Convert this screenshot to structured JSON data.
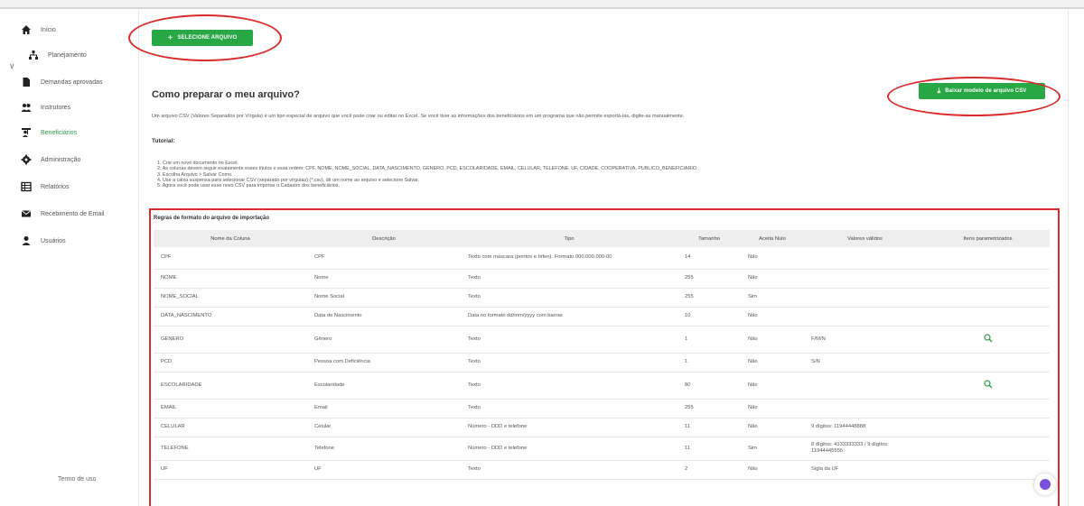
{
  "sidebar": {
    "items": [
      {
        "label": "Início",
        "icon": "home-icon"
      },
      {
        "label": "Planejamento",
        "icon": "sitemap-icon"
      },
      {
        "label": "Demandas aprovadas",
        "icon": "document-icon"
      },
      {
        "label": "Instrutores",
        "icon": "users-icon"
      },
      {
        "label": "Beneficiários",
        "icon": "person-board-icon"
      },
      {
        "label": "Administração",
        "icon": "gear-icon"
      },
      {
        "label": "Relatórios",
        "icon": "table-icon"
      },
      {
        "label": "Recebimento de Email",
        "icon": "envelope-icon"
      },
      {
        "label": "Usuários",
        "icon": "user-icon"
      }
    ],
    "active_index": 4,
    "terms": "Termo de uso"
  },
  "main": {
    "select_button": "SELECIONE ARQUIVO",
    "download_button": "Baixar modelo de arquivo CSV",
    "title": "Como preparar o meu arquivo?",
    "description": "Um arquivo CSV (Valores Separados por Vírgula) é um tipo especial de arquivo que você pode criar ou editar no Excel. Se você tiver as informações dos beneficiários em um programa que não permite exportá-las, digite-as manualmente.",
    "tutorial_title": "Tutorial:",
    "steps": [
      "1. Crie um novo documento no Excel.",
      "2. As colunas devem seguir exatamente esses títulos e essa ordem: CPF, NOME, NOME_SOCIAL, DATA_NASCIMENTO, GENERO, PCD, ESCOLARIDADE, EMAIL, CELULAR, TELEFONE, UF, CIDADE, COOPERATIVA, PUBLICO_BENEFICIARIO.",
      "3. Escolha Arquivo > Salvar Como.",
      "4. Use a caixa suspensa para selecionar CSV (separado por vírgulas) (*.csv), dê um nome ao arquivo e selecione Salvar.",
      "5. Agora você pode usar esse novo CSV para importar o Cadastro dos beneficiários."
    ]
  },
  "table": {
    "title": "Regras de formato do arquivo de importação",
    "headers": [
      "Nome da Coluna",
      "Descrição",
      "Tipo",
      "Tamanho",
      "Aceita Nulo",
      "Valores válidos",
      "Itens parametrizados"
    ],
    "rows": [
      {
        "name": "CPF",
        "desc": "CPF",
        "type": "Texto com máscara (pontos e hífen). Formato 000.000.000-00",
        "size": "14",
        "null": "Não",
        "valid": "",
        "param": ""
      },
      {
        "name": "NOME",
        "desc": "Nome",
        "type": "Texto",
        "size": "255",
        "null": "Não",
        "valid": "",
        "param": ""
      },
      {
        "name": "NOME_SOCIAL",
        "desc": "Nome Social",
        "type": "Texto",
        "size": "255",
        "null": "Sim",
        "valid": "",
        "param": ""
      },
      {
        "name": "DATA_NASCIMENTO",
        "desc": "Data de Nascimento",
        "type": "Data no formato dd/mm/yyyy com barras",
        "size": "10",
        "null": "Não",
        "valid": "",
        "param": ""
      },
      {
        "name": "GENERO",
        "desc": "Gênero",
        "type": "Texto",
        "size": "1",
        "null": "Não",
        "valid": "F/M/N",
        "param": "search-icon"
      },
      {
        "name": "PCD",
        "desc": "Pessoa com Deficiência",
        "type": "Texto",
        "size": "1",
        "null": "Não",
        "valid": "S/N",
        "param": ""
      },
      {
        "name": "ESCOLARIDADE",
        "desc": "Escolaridade",
        "type": "Texto",
        "size": "80",
        "null": "Não",
        "valid": "",
        "param": "search-icon"
      },
      {
        "name": "EMAIL",
        "desc": "Email",
        "type": "Texto",
        "size": "255",
        "null": "Não",
        "valid": "",
        "param": ""
      },
      {
        "name": "CELULAR",
        "desc": "Celular",
        "type": "Número - DDD e telefone",
        "size": "11",
        "null": "Não",
        "valid": "9 dígitos: 11944448888",
        "param": ""
      },
      {
        "name": "TELEFONE",
        "desc": "Telefone",
        "type": "Número - DDD e telefone",
        "size": "11",
        "null": "Sim",
        "valid": "8 dígitos: 4133333333 / 9 dígitos: 11944445555",
        "param": ""
      },
      {
        "name": "UF",
        "desc": "UF",
        "type": "Texto",
        "size": "2",
        "null": "Não",
        "valid": "Sigla da UF",
        "param": ""
      }
    ]
  },
  "colors": {
    "accent": "#28a745",
    "annotation": "#d92b2b",
    "active_nav": "#2e9b4b"
  }
}
